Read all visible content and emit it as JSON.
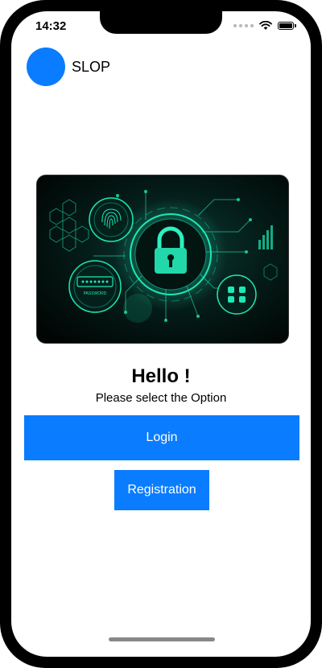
{
  "status_bar": {
    "time": "14:32"
  },
  "header": {
    "app_name": "SLOP"
  },
  "hero": {
    "icon": "lock-icon",
    "caption": "PASSWORD"
  },
  "main": {
    "greeting": "Hello !",
    "subtitle": "Please select the Option",
    "login_label": "Login",
    "registration_label": "Registration"
  },
  "colors": {
    "accent": "#0a7cff",
    "hero_glow": "#1de9b6",
    "hero_bg": "#03120f"
  }
}
